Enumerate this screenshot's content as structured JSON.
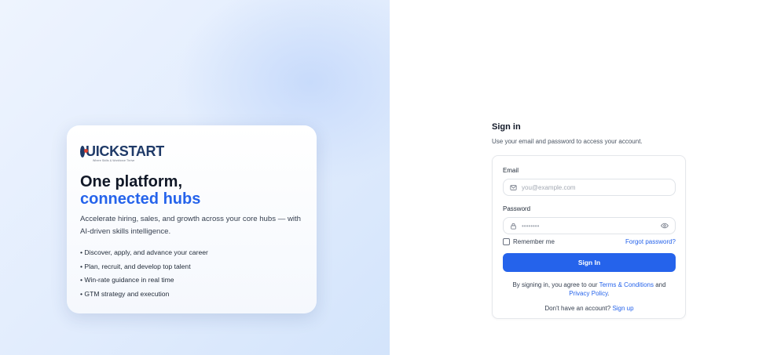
{
  "hero": {
    "logo_text": "UICKSTART",
    "logo_tagline": "Where Skills & Workforce Thrive",
    "title_line1": "One platform,",
    "title_line2": "connected hubs",
    "description": "Accelerate hiring, sales, and growth across your core hubs — with AI-driven skills intelligence.",
    "bullets": [
      "• Discover, apply, and advance your career",
      "• Plan, recruit, and develop top talent",
      "• Win-rate guidance in real time",
      "• GTM strategy and execution"
    ]
  },
  "signin": {
    "title": "Sign in",
    "subtitle": "Use your email and password to access your account.",
    "email_label": "Email",
    "email_placeholder": "you@example.com",
    "password_label": "Password",
    "password_placeholder": "••••••••",
    "remember_label": "Remember me",
    "forgot_label": "Forgot password?",
    "submit_label": "Sign In",
    "terms_prefix": "By signing in, you agree to our ",
    "terms_link": "Terms & Conditions",
    "terms_and": " and",
    "privacy_link": "Privacy Policy",
    "terms_suffix": ".",
    "no_account_text": "Don't have an account? ",
    "signup_link": "Sign up"
  },
  "colors": {
    "accent": "#2563eb",
    "logo_navy": "#1f3a68",
    "logo_red": "#e0412e"
  },
  "icons": {
    "email": "mail-icon",
    "password": "lock-icon",
    "toggle": "eye-icon"
  }
}
